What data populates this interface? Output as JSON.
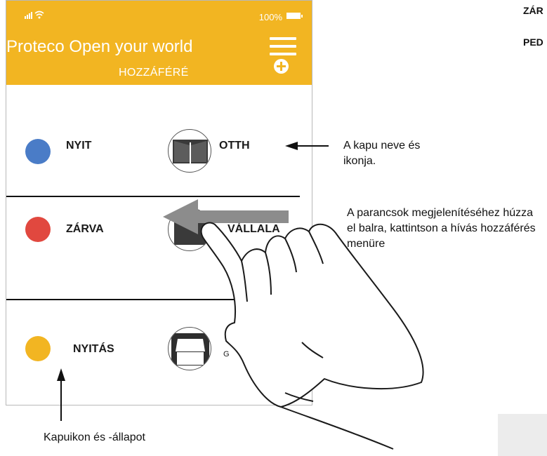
{
  "status_bar": {
    "battery": "100%"
  },
  "header": {
    "title": "Proteco Open your world",
    "tab": "HOZZÁFÉRÉ"
  },
  "gates": [
    {
      "status": "NYIT",
      "name": "OTTH",
      "status_color": "#4a7cc7"
    },
    {
      "status": "ZÁRVA",
      "name": "VÁLLALA",
      "status_color": "#e1483f"
    },
    {
      "status": "NYITÁS",
      "name": "G",
      "status_color": "#f2b522"
    }
  ],
  "annotations": {
    "gate_name": "A kapu neve és ikonja.",
    "swipe": "A parancsok megjelenítéséhez húzza el balra, kattintson a hívás hozzáférés menüre",
    "gates_status": "Kapuikon és -állapot"
  },
  "side_labels": {
    "top": "ZÁR",
    "second": "PED"
  },
  "colors": {
    "accent": "#f2b522",
    "arrow": "#8c8c8c"
  }
}
